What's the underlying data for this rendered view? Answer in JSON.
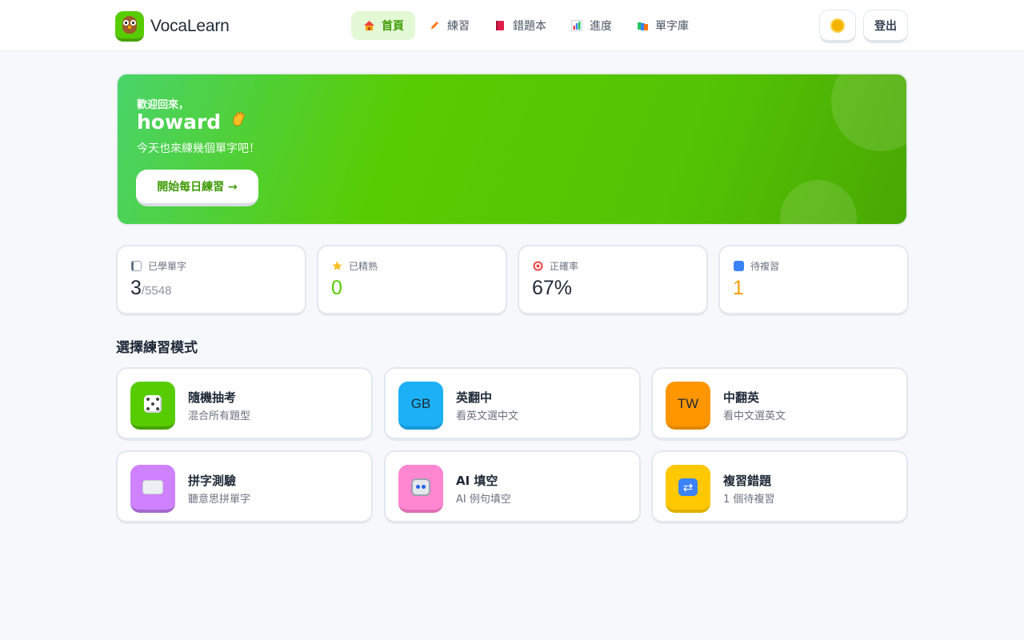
{
  "app": {
    "name": "VocaLearn"
  },
  "nav": {
    "items": [
      {
        "label": "首頁",
        "icon": "home-icon",
        "active": true
      },
      {
        "label": "練習",
        "icon": "pencil-icon",
        "active": false
      },
      {
        "label": "錯題本",
        "icon": "notebook-icon",
        "active": false
      },
      {
        "label": "進度",
        "icon": "bar-chart-icon",
        "active": false
      },
      {
        "label": "單字庫",
        "icon": "books-icon",
        "active": false
      }
    ]
  },
  "header": {
    "theme_icon": "sun-icon",
    "logout_label": "登出"
  },
  "hero": {
    "greeting": "歡迎回來，",
    "username": "howard",
    "wave_icon": "waving-hand-icon",
    "subtitle": "今天也來練幾個單字吧！",
    "cta_label": "開始每日練習 →"
  },
  "stats": [
    {
      "label": "已學單字",
      "icon": "book-icon",
      "value": "3",
      "total": "/5548",
      "color": "#1f2937"
    },
    {
      "label": "已精熟",
      "icon": "star-icon",
      "value": "0",
      "color": "#58cc02"
    },
    {
      "label": "正確率",
      "icon": "target-icon",
      "value": "67%",
      "color": "#1f2937"
    },
    {
      "label": "待複習",
      "icon": "repeat-icon",
      "value": "1",
      "color": "#f59e0b"
    }
  ],
  "modes_title": "選擇練習模式",
  "modes": [
    {
      "title": "隨機抽考",
      "desc": "混合所有題型",
      "icon": "dice-icon",
      "color": "#58cc02",
      "shade": "#46a302"
    },
    {
      "title": "英翻中",
      "desc": "看英文選中文",
      "icon": "flag-gb-icon",
      "icon_text": "GB",
      "color": "#1cb0f6",
      "shade": "#1899d6"
    },
    {
      "title": "中翻英",
      "desc": "看中文選英文",
      "icon": "flag-tw-icon",
      "icon_text": "TW",
      "color": "#ff9600",
      "shade": "#e08600"
    },
    {
      "title": "拼字測驗",
      "desc": "聽意思拼單字",
      "icon": "keyboard-icon",
      "color": "#ce82ff",
      "shade": "#a568cc"
    },
    {
      "title": "AI 填空",
      "desc": "AI 例句填空",
      "icon": "robot-icon",
      "color": "#ff86d0",
      "shade": "#e06fb6"
    },
    {
      "title": "複習錯題",
      "desc": "1 個待複習",
      "icon": "repeat-icon",
      "color": "#ffc800",
      "shade": "#e0b000"
    }
  ]
}
